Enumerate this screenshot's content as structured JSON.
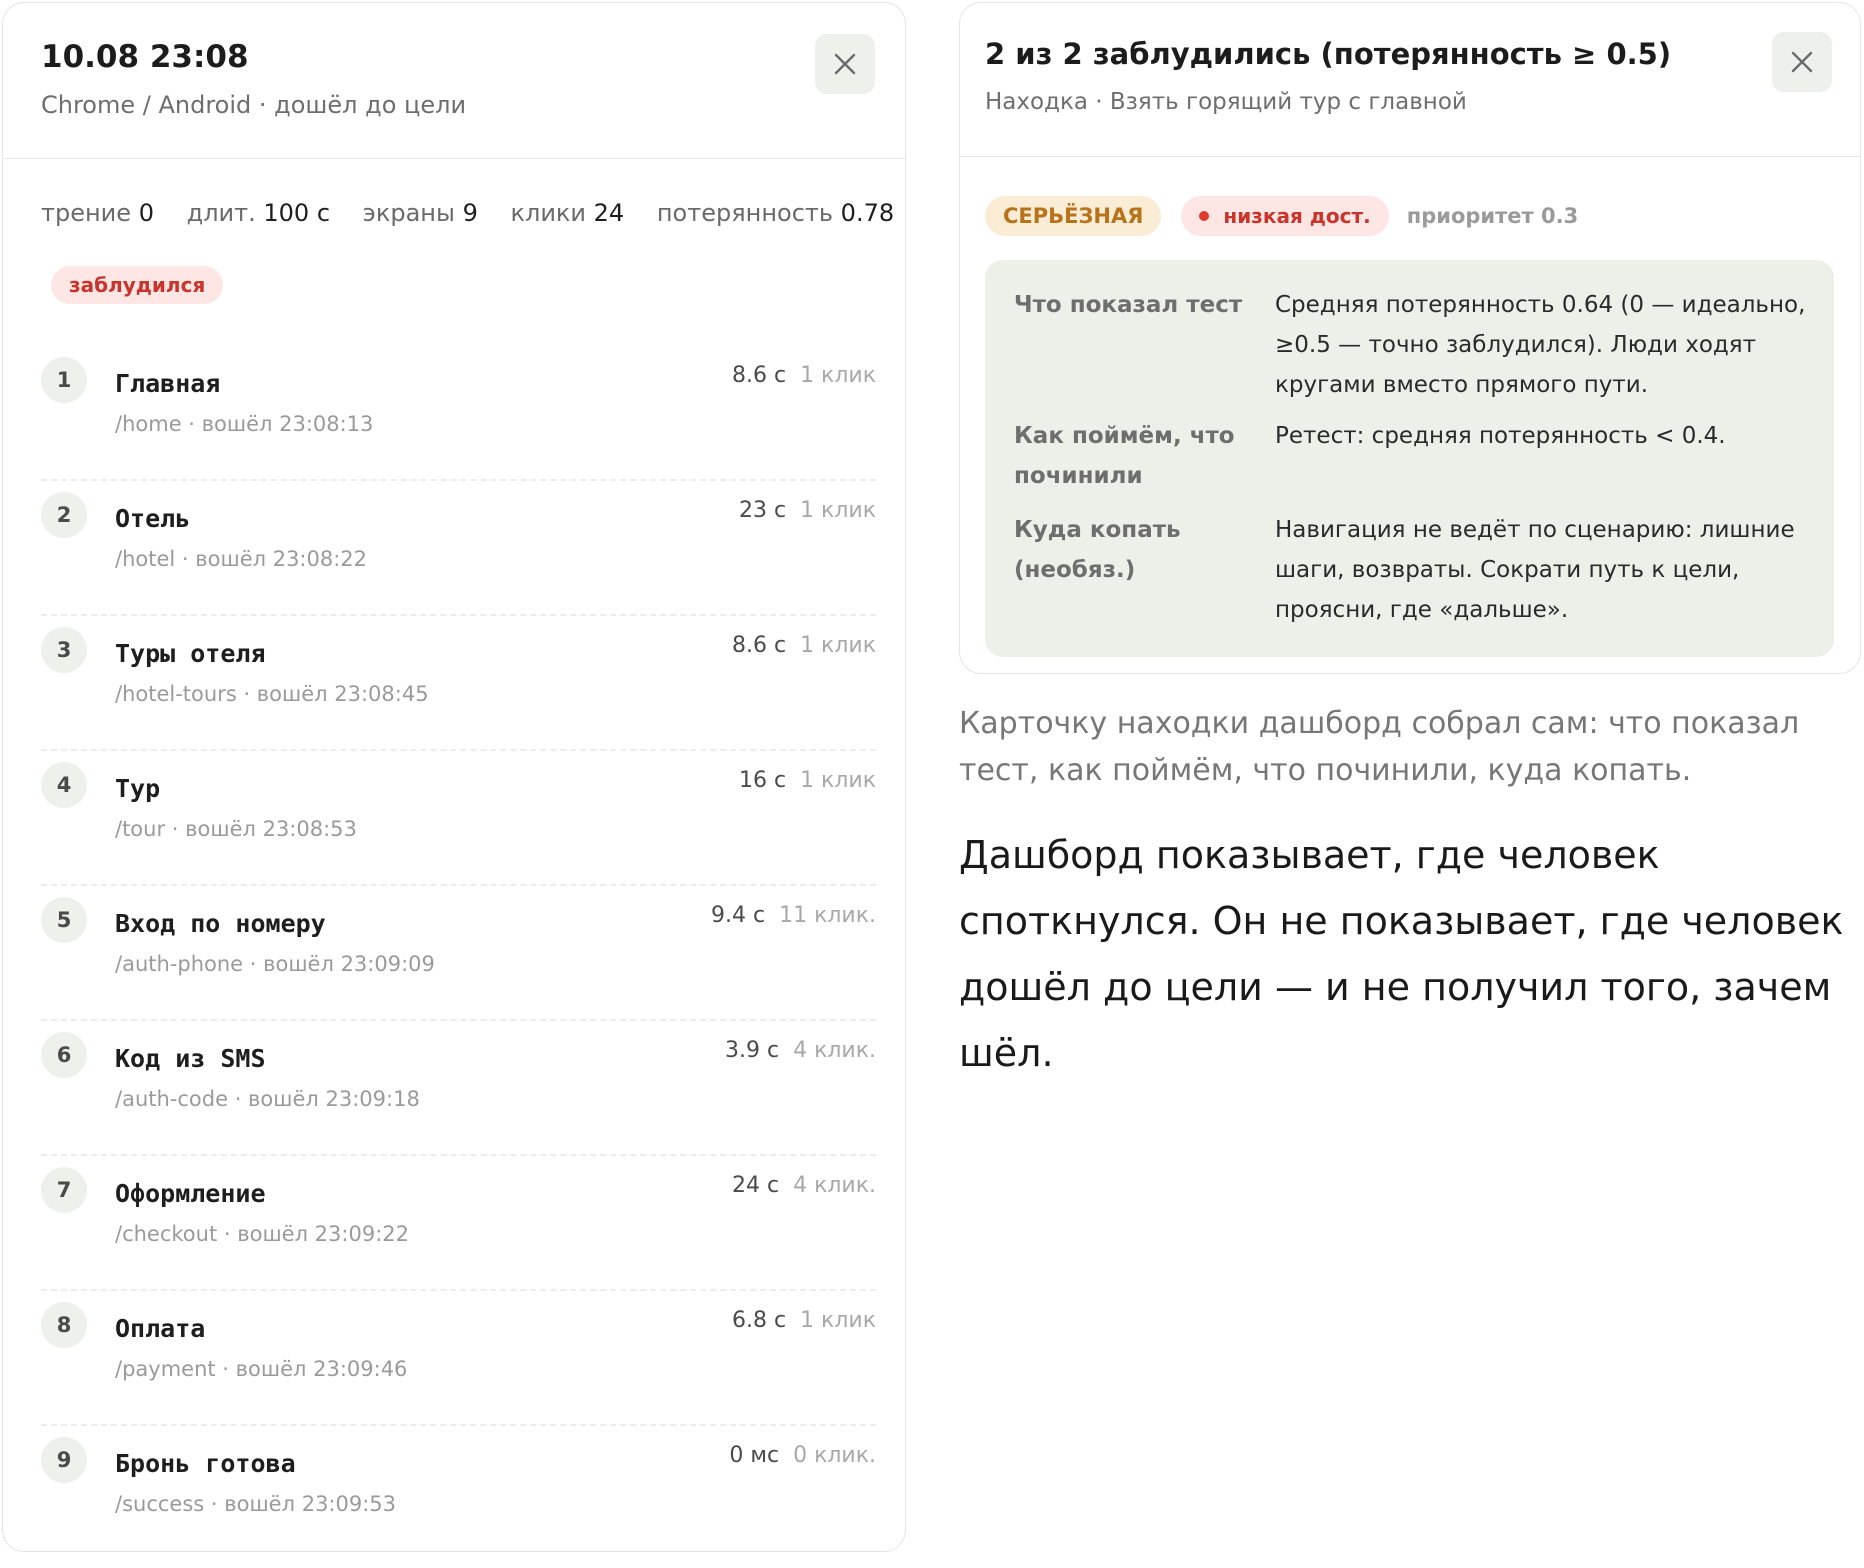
{
  "session": {
    "title": "10.08 23:08",
    "subtitle": "Chrome / Android · дошёл до цели",
    "close_icon": "close-icon",
    "stats": [
      {
        "label": "трение",
        "value": "0"
      },
      {
        "label": "длит.",
        "value": "100 с"
      },
      {
        "label": "экраны",
        "value": "9"
      },
      {
        "label": "клики",
        "value": "24"
      },
      {
        "label": "потерянность",
        "value": "0.78"
      }
    ],
    "status_badge": "заблудился",
    "steps": [
      {
        "num": "1",
        "name": "Главная",
        "meta": "/home · вошёл 23:08:13",
        "duration": "8.6 с",
        "clicks": "1 клик"
      },
      {
        "num": "2",
        "name": "Отель",
        "meta": "/hotel · вошёл 23:08:22",
        "duration": "23 с",
        "clicks": "1 клик"
      },
      {
        "num": "3",
        "name": "Туры отеля",
        "meta": "/hotel-tours · вошёл 23:08:45",
        "duration": "8.6 с",
        "clicks": "1 клик"
      },
      {
        "num": "4",
        "name": "Тур",
        "meta": "/tour · вошёл 23:08:53",
        "duration": "16 с",
        "clicks": "1 клик"
      },
      {
        "num": "5",
        "name": "Вход по номеру",
        "meta": "/auth-phone · вошёл 23:09:09",
        "duration": "9.4 с",
        "clicks": "11 клик."
      },
      {
        "num": "6",
        "name": "Код из SMS",
        "meta": "/auth-code · вошёл 23:09:18",
        "duration": "3.9 с",
        "clicks": "4 клик."
      },
      {
        "num": "7",
        "name": "Оформление",
        "meta": "/checkout · вошёл 23:09:22",
        "duration": "24 с",
        "clicks": "4 клик."
      },
      {
        "num": "8",
        "name": "Оплата",
        "meta": "/payment · вошёл 23:09:46",
        "duration": "6.8 с",
        "clicks": "1 клик"
      },
      {
        "num": "9",
        "name": "Бронь готова",
        "meta": "/success · вошёл 23:09:53",
        "duration": "0 мс",
        "clicks": "0 клик."
      }
    ]
  },
  "finding": {
    "title": "2 из 2 заблудились (потерянность ≥ 0.5)",
    "subtitle": "Находка · Взять горящий тур с главной",
    "close_icon": "close-icon",
    "severity": "СЕРЬЁЗНАЯ",
    "accessibility": "низкая дост.",
    "priority_label": "приоритет",
    "priority_value": "0.3",
    "rows": [
      {
        "label": "Что показал тест",
        "value": "Средняя потерянность 0.64 (0 — идеально, ≥0.5 — точно заблудился). Люди ходят кругами вместо прямого пути."
      },
      {
        "label": "Как поймём, что починили",
        "value": "Ретест: средняя потерянность < 0.4."
      },
      {
        "label": "Куда копать (необяз.)",
        "value": "Навигация не ведёт по сценарию: лишние шаги, возвраты. Сократи путь к цели, проясни, где «дальше»."
      }
    ]
  },
  "caption": "Карточку находки дашборд собрал сам: что показал тест, как поймём, что починили, куда копать.",
  "main_text": "Дашборд показывает, где человек споткнулся. Он не показывает, где человек дошёл до цели — и не получил того, зачем шёл."
}
